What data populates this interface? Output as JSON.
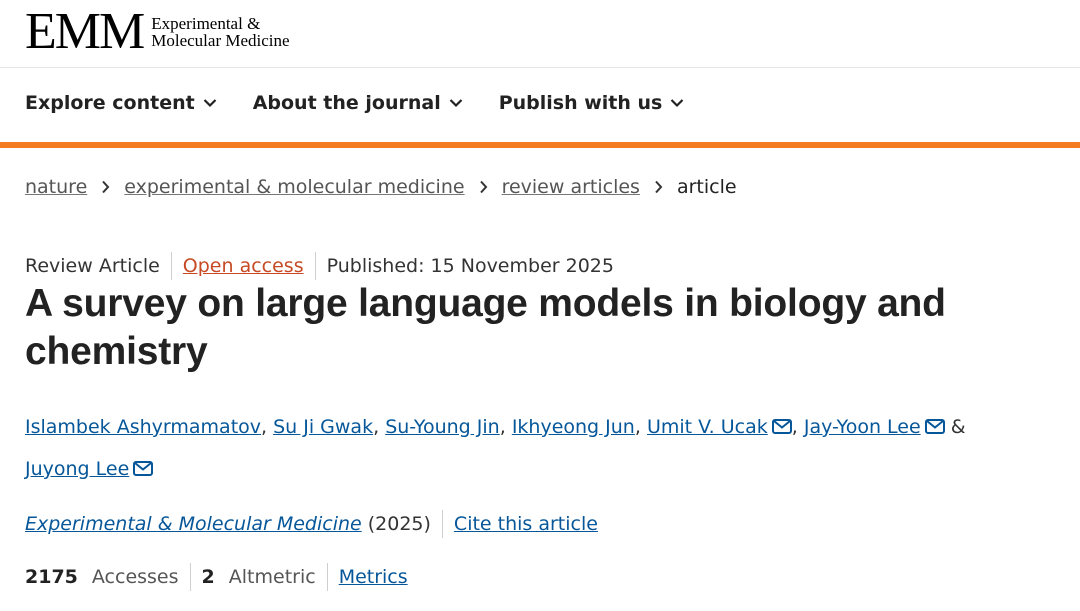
{
  "brand": {
    "logo_mark": "EMM",
    "logo_line1": "Experimental &",
    "logo_line2": "Molecular Medicine"
  },
  "nav": {
    "items": [
      {
        "label": "Explore content"
      },
      {
        "label": "About the journal"
      },
      {
        "label": "Publish with us"
      }
    ]
  },
  "breadcrumb": {
    "items": [
      "nature",
      "experimental & molecular medicine",
      "review articles"
    ],
    "current": "article"
  },
  "article": {
    "type": "Review Article",
    "access": "Open access",
    "published": "Published: 15 November 2025",
    "title": "A survey on large language models in biology and chemistry",
    "authors": [
      "Islambek Ashyrmamatov",
      "Su Ji Gwak",
      "Su-Young Jin",
      "Ikhyeong Jun",
      "Umit V. Ucak",
      "Jay-Yoon Lee",
      "Juyong Lee"
    ],
    "authors_sep": ",",
    "authors_and": "&",
    "journal": "Experimental & Molecular Medicine",
    "year": "(2025)",
    "cite": "Cite this article",
    "accesses_value": "2175",
    "accesses_label": "Accesses",
    "altmetric_value": "2",
    "altmetric_label": "Altmetric",
    "metrics": "Metrics"
  },
  "colors": {
    "accent": "#f47b20",
    "link": "#06579a",
    "open_access": "#c74a24"
  }
}
